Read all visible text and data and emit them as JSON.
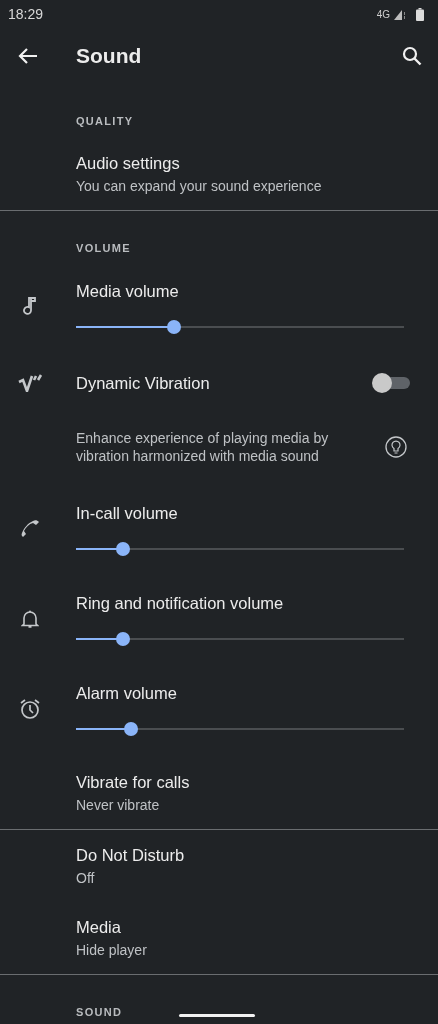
{
  "status_bar": {
    "time": "18:29",
    "network": "4G"
  },
  "toolbar": {
    "title": "Sound"
  },
  "sections": [
    {
      "header": "QUALITY",
      "items": [
        {
          "kind": "text",
          "title": "Audio settings",
          "subtitle": "You can expand your sound experience"
        }
      ]
    },
    {
      "header": "VOLUME",
      "items": [
        {
          "kind": "slider",
          "title": "Media volume",
          "level": 0.3
        },
        {
          "kind": "toggle",
          "title": "Dynamic Vibration",
          "on": false
        },
        {
          "kind": "description",
          "text": "Enhance experience of playing media by vibration harmonized with media sound"
        },
        {
          "kind": "slider",
          "title": "In-call volume",
          "level": 0.143
        },
        {
          "kind": "slider",
          "title": "Ring and notification volume",
          "level": 0.143
        },
        {
          "kind": "slider",
          "title": "Alarm volume",
          "level": 0.168
        },
        {
          "kind": "text",
          "title": "Vibrate for calls",
          "subtitle": "Never vibrate"
        }
      ]
    },
    {
      "items": [
        {
          "kind": "text",
          "title": "Do Not Disturb",
          "subtitle": "Off"
        },
        {
          "kind": "text",
          "title": "Media",
          "subtitle": "Hide player"
        }
      ]
    },
    {
      "header": "SOUND"
    }
  ]
}
